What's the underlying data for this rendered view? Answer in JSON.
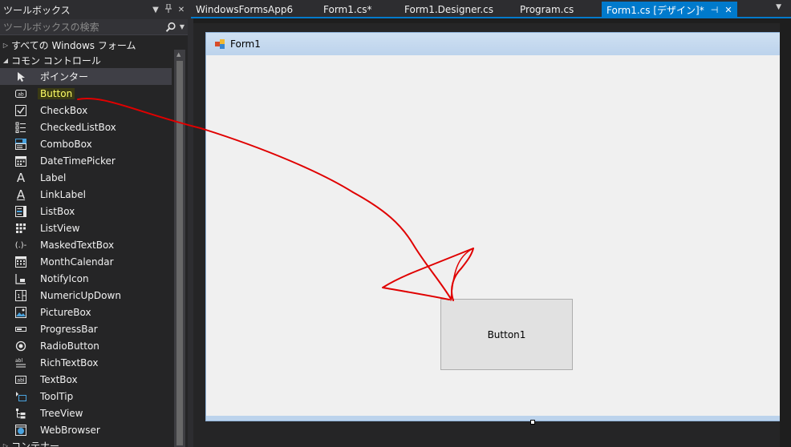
{
  "toolbox": {
    "title": "ツールボックス",
    "search_placeholder": "ツールボックスの検索",
    "categories": {
      "all": "すべての Windows フォーム",
      "common": "コモン コントロール",
      "containers": "コンテナー"
    },
    "items": [
      {
        "label": "ポインター",
        "icon": "pointer-icon"
      },
      {
        "label": "Button",
        "icon": "button-icon"
      },
      {
        "label": "CheckBox",
        "icon": "checkbox-icon"
      },
      {
        "label": "CheckedListBox",
        "icon": "checkedlistbox-icon"
      },
      {
        "label": "ComboBox",
        "icon": "combobox-icon"
      },
      {
        "label": "DateTimePicker",
        "icon": "datetimepicker-icon"
      },
      {
        "label": "Label",
        "icon": "label-icon"
      },
      {
        "label": "LinkLabel",
        "icon": "linklabel-icon"
      },
      {
        "label": "ListBox",
        "icon": "listbox-icon"
      },
      {
        "label": "ListView",
        "icon": "listview-icon"
      },
      {
        "label": "MaskedTextBox",
        "icon": "maskedtextbox-icon"
      },
      {
        "label": "MonthCalendar",
        "icon": "monthcalendar-icon"
      },
      {
        "label": "NotifyIcon",
        "icon": "notifyicon-icon"
      },
      {
        "label": "NumericUpDown",
        "icon": "numericupdown-icon"
      },
      {
        "label": "PictureBox",
        "icon": "picturebox-icon"
      },
      {
        "label": "ProgressBar",
        "icon": "progressbar-icon"
      },
      {
        "label": "RadioButton",
        "icon": "radiobutton-icon"
      },
      {
        "label": "RichTextBox",
        "icon": "richtextbox-icon"
      },
      {
        "label": "TextBox",
        "icon": "textbox-icon"
      },
      {
        "label": "ToolTip",
        "icon": "tooltip-icon"
      },
      {
        "label": "TreeView",
        "icon": "treeview-icon"
      },
      {
        "label": "WebBrowser",
        "icon": "webbrowser-icon"
      }
    ]
  },
  "tabs": [
    {
      "label": "WindowsFormsApp6"
    },
    {
      "label": "Form1.cs*"
    },
    {
      "label": "Form1.Designer.cs"
    },
    {
      "label": "Program.cs"
    },
    {
      "label": "Form1.cs [デザイン]*"
    }
  ],
  "form": {
    "title": "Form1",
    "button_label": "Button1"
  },
  "colors": {
    "accent": "#007acc",
    "annotation": "#e00000",
    "highlight_text": "#ffff66"
  }
}
